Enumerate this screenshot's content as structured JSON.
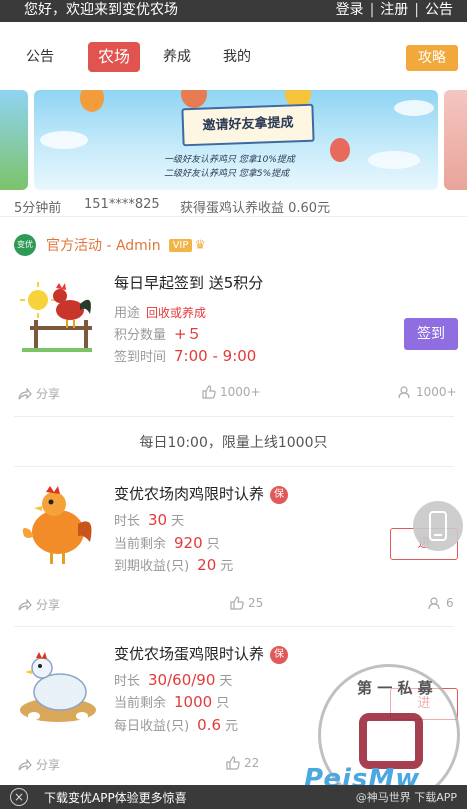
{
  "topbar": {
    "welcome": "您好，欢迎来到变优农场",
    "login": "登录",
    "register": "注册",
    "notice": "公告"
  },
  "nav": {
    "tabs": [
      {
        "label": "公告"
      },
      {
        "label": "农场"
      },
      {
        "label": "养成"
      },
      {
        "label": "我的"
      }
    ],
    "active": "农场",
    "guide_label": "攻略"
  },
  "banner": {
    "title": "邀请好友拿提成",
    "line1": "一级好友认养鸡只 您拿10%提成",
    "line2": "二级好友认养鸡只 您拿5%提成"
  },
  "ticker": {
    "time": "5分钟前",
    "user": "151****825",
    "text": "获得蛋鸡认养收益 0.60元"
  },
  "official": {
    "logo_text": "变优",
    "name": "官方活动 - Admin",
    "vip": "VIP"
  },
  "signin_card": {
    "title": "每日早起签到 送5积分",
    "usage_label": "用途",
    "usage_value": "回收或养成",
    "points_label": "积分数量",
    "points_value": "+５",
    "time_label": "签到时间",
    "time_value": "7:00 - 9:00",
    "button": "签到",
    "share": "分享",
    "likes": "1000+",
    "users": "1000+"
  },
  "limit_notice": "每日10:00，限量上线1000只",
  "products": [
    {
      "title": "变优农场肉鸡限时认养",
      "badge": "保",
      "duration_label": "时长",
      "duration_value": "30",
      "duration_unit": "天",
      "remain_label": "当前剩余",
      "remain_value": "920",
      "remain_unit": "只",
      "income_label": "到期收益(只)",
      "income_value": "20",
      "income_unit": "元",
      "button": "进",
      "share": "分享",
      "likes": "25",
      "users": "6"
    },
    {
      "title": "变优农场蛋鸡限时认养",
      "badge": "保",
      "duration_label": "时长",
      "duration_value": "30/60/90",
      "duration_unit": "天",
      "remain_label": "当前剩余",
      "remain_value": "1000",
      "remain_unit": "只",
      "income_label": "每日收益(只)",
      "income_value": "0.6",
      "income_unit": "元",
      "button": "进",
      "share": "分享",
      "likes": "22",
      "users": ""
    }
  ],
  "watermark": {
    "text": "第 一 私 募"
  },
  "brand_overlay": "PeisMw",
  "bottombar": {
    "message": "下载变优APP体验更多惊喜",
    "right": "@神马世界 下载APP"
  },
  "colors": {
    "topbar_bg": "#3a3a3a",
    "active_tab": "#e0534f",
    "guide": "#f1a93b",
    "sign_button": "#8e6ee0",
    "accent_red": "#e23a3a",
    "official_orange": "#e0753a"
  }
}
